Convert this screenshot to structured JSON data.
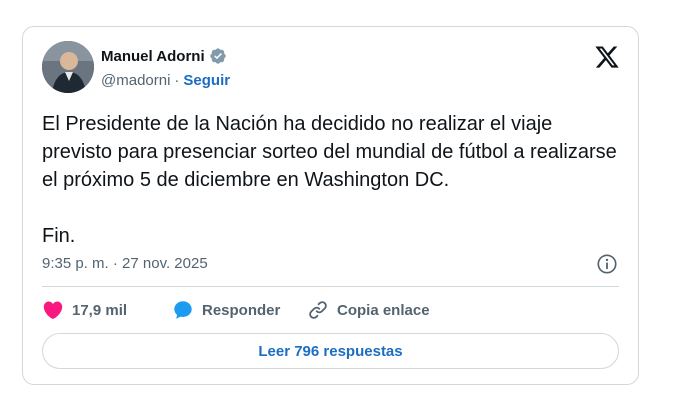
{
  "author": {
    "name": "Manuel Adorni",
    "handle": "@madorni",
    "separator": "·",
    "follow_label": "Seguir"
  },
  "post": {
    "text": "El Presidente de la Nación ha decidido no realizar el viaje previsto para presenciar sorteo del mundial de fútbol a realizarse el próximo 5 de diciembre en Washington DC.",
    "closing": "Fin.",
    "timestamp": "9:35 p. m. · 27 nov. 2025"
  },
  "actions": {
    "likes": "17,9 mil",
    "reply_label": "Responder",
    "copy_label": "Copia enlace"
  },
  "replies_button": "Leer 796 respuestas",
  "colors": {
    "accent": "#1d6ec2",
    "like": "#f91880",
    "reply_icon": "#1d9bf0",
    "verified": "#829aab"
  },
  "icons": [
    "verified-badge-icon",
    "x-logo-icon",
    "info-icon",
    "heart-icon",
    "reply-bubble-icon",
    "link-icon"
  ]
}
